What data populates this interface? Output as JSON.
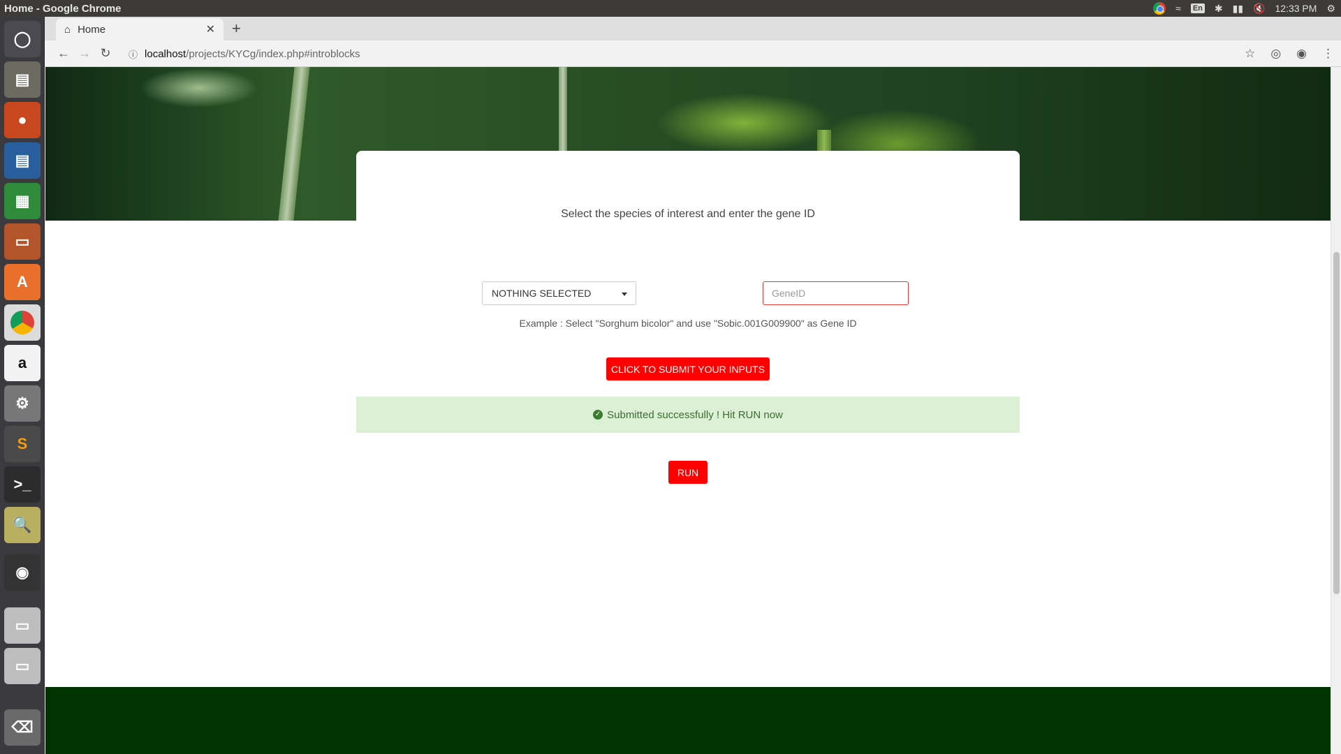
{
  "os": {
    "window_title": "Home - Google Chrome",
    "keyboard_layout": "En",
    "clock": "12:33 PM"
  },
  "browser": {
    "tab": {
      "title": "Home"
    },
    "url_host": "localhost",
    "url_path": "/projects/KYCg/index.php#introblocks"
  },
  "launcher": {
    "apps": [
      "ubuntu-dash-icon",
      "files-icon",
      "firefox-icon",
      "writer-icon",
      "calc-icon",
      "impress-icon",
      "software-center-icon",
      "chrome-icon",
      "amazon-icon",
      "system-settings-icon",
      "sublime-text-icon",
      "terminal-icon",
      "image-viewer-icon",
      "disk-icon",
      "drive-icon",
      "drive-icon",
      "trash-icon"
    ]
  },
  "page": {
    "instruction": "Select the species of interest and enter the gene ID",
    "species_select": {
      "selected": "NOTHING SELECTED"
    },
    "gene_input": {
      "placeholder": "GeneID",
      "value": ""
    },
    "example_text": "Example : Select \"Sorghum bicolor\" and use \"Sobic.001G009900\" as Gene ID",
    "submit_button": "CLICK TO SUBMIT YOUR INPUTS",
    "alert": "Submitted successfully ! Hit RUN now",
    "run_button": "RUN"
  },
  "colors": {
    "accent_red": "#ff0000",
    "alert_bg": "#dcf0d6",
    "alert_text": "#3a6d2f",
    "footer_green": "#003300"
  }
}
